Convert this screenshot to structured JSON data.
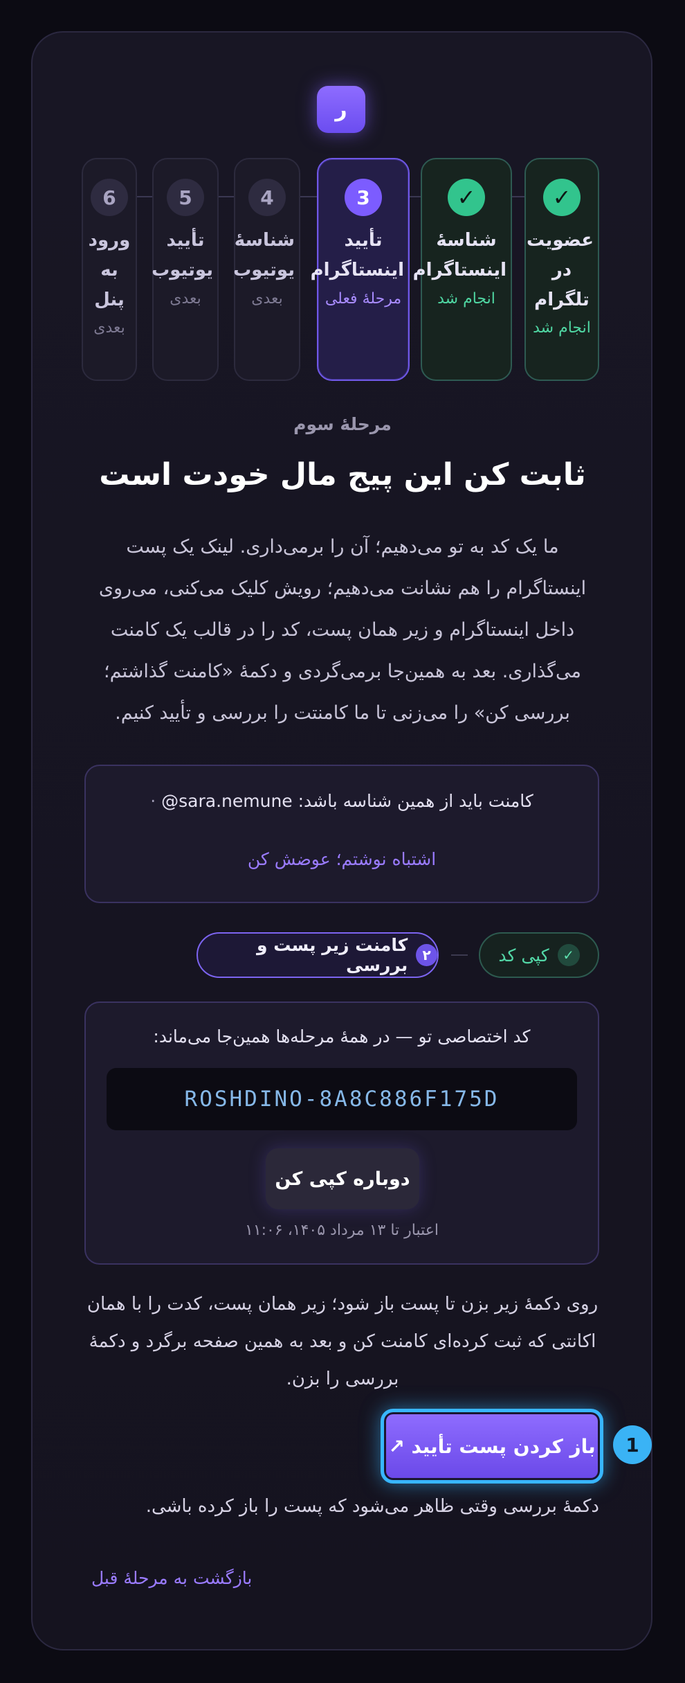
{
  "brand": {
    "logo_letter": "ر"
  },
  "steps": [
    {
      "number": "✓",
      "title": "عضویت در تلگرام",
      "status": "انجام شد",
      "state": "done"
    },
    {
      "number": "✓",
      "title": "شناسهٔ اینستاگرام",
      "status": "انجام شد",
      "state": "done"
    },
    {
      "number": "3",
      "title": "تأیید اینستاگرام",
      "status": "مرحلهٔ فعلی",
      "state": "current"
    },
    {
      "number": "4",
      "title": "شناسهٔ یوتیوب",
      "status": "بعدی",
      "state": "upcoming"
    },
    {
      "number": "5",
      "title": "تأیید یوتیوب",
      "status": "بعدی",
      "state": "upcoming"
    },
    {
      "number": "6",
      "title": "ورود به پنل",
      "status": "بعدی",
      "state": "upcoming"
    }
  ],
  "main": {
    "eyebrow": "مرحلهٔ سوم",
    "headline": "ثابت کن این پیج مال خودت است",
    "intro": "ما یک کد به تو می‌دهیم؛ آن را برمی‌داری. لینک یک پست اینستاگرام را هم نشانت می‌دهیم؛ رویش کلیک می‌کنی، می‌روی داخل اینستاگرام و زیر همان پست، کد را در قالب یک کامنت می‌گذاری. بعد به همین‌جا برمی‌گردی و دکمهٔ «کامنت گذاشتم؛ بررسی کن» را می‌زنی تا ما کامنتت را بررسی و تأیید کنیم."
  },
  "identity": {
    "prefix": "کامنت باید از همین شناسه باشد:",
    "handle": "@sara.nemune",
    "dot": "·",
    "fix_link": "اشتباه نوشتم؛ عوضش کن"
  },
  "progress": {
    "copy_label": "کپی کد",
    "copy_badge": "✓",
    "comment_label": "کامنت زیر پست و بررسی",
    "comment_badge": "۲"
  },
  "code_panel": {
    "label": "کد اختصاصی تو — در همهٔ مرحله‌ها همین‌جا می‌ماند:",
    "code": "ROSHDINO-8A8C886F175D",
    "recopy_button": "دوباره کپی کن",
    "expiry": "اعتبار تا ۱۳ مرداد ۱۴۰۵، ۱۱:۰۶"
  },
  "instructions": "روی دکمهٔ زیر بزن تا پست باز شود؛ زیر همان پست، کدت را با همان اکانتی که ثبت کرده‌ای کامنت کن و بعد به همین صفحه برگرد و دکمهٔ بررسی را بزن.",
  "primary_button": "باز کردن پست تأیید ↗",
  "marker": "1",
  "hint": "دکمهٔ بررسی وقتی ظاهر می‌شود که پست را باز کرده باشی.",
  "back_link": "بازگشت به مرحلهٔ قبل",
  "colors": {
    "accent": "#7c5cff",
    "success": "#32c48d",
    "highlight": "#38b6ff",
    "background": "#0c0b13"
  }
}
